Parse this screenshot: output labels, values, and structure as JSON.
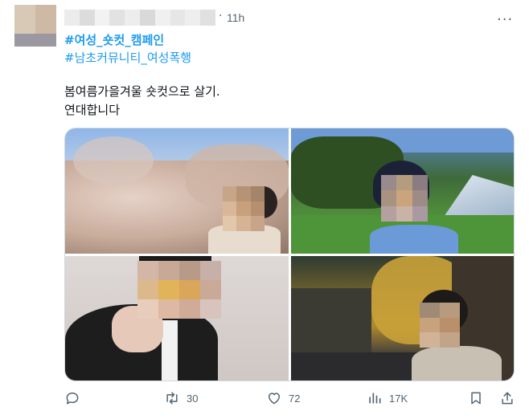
{
  "tweet": {
    "time": "11h",
    "separator": "·",
    "more": "···",
    "hashtags": [
      "#여성_숏컷_캠페인",
      "#남초커뮤니티_여성폭행"
    ],
    "text_lines": [
      "봄여름가을겨울 숏컷으로 살기.",
      "연대합니다"
    ]
  },
  "photos": [
    {
      "content": "cherry-blossom-photo"
    },
    {
      "content": "park-photo"
    },
    {
      "content": "indoor-photo"
    },
    {
      "content": "autumn-street-photo"
    }
  ],
  "actions": {
    "reply": {
      "icon": "reply-icon",
      "count": ""
    },
    "retweet": {
      "icon": "retweet-icon",
      "count": "30"
    },
    "like": {
      "icon": "heart-icon",
      "count": "72"
    },
    "views": {
      "icon": "views-icon",
      "count": "17K"
    },
    "bookmark": {
      "icon": "bookmark-icon",
      "count": ""
    },
    "share": {
      "icon": "share-icon",
      "count": ""
    }
  },
  "colors": {
    "link": "#1d9bf0",
    "text": "#0f1419",
    "secondary": "#536471",
    "border": "#cfd9de"
  }
}
